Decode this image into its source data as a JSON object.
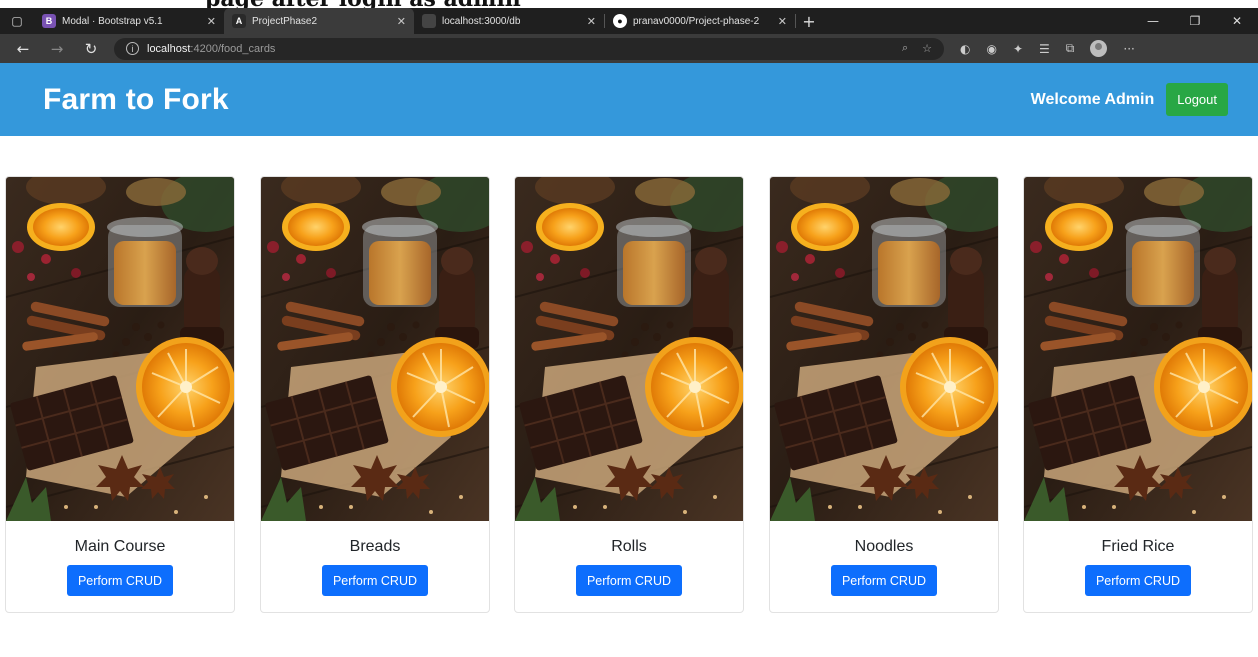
{
  "caption": "page after login as admin",
  "browser": {
    "tabs": [
      {
        "title": "Modal · Bootstrap v5.1",
        "favicon": "B",
        "favicon_color": "#7952b3",
        "active": false
      },
      {
        "title": "ProjectPhase2",
        "favicon": "A",
        "favicon_color": "#ffffff",
        "active": true
      },
      {
        "title": "localhost:3000/db",
        "favicon": "",
        "favicon_color": "#555555",
        "active": false
      },
      {
        "title": "pranav0000/Project-phase-2",
        "favicon": "github",
        "favicon_color": "#ffffff",
        "active": false
      }
    ],
    "url_host": "localhost",
    "url_path": ":4200/food_cards"
  },
  "navbar": {
    "brand": "Farm to Fork",
    "welcome": "Welcome Admin",
    "logout_label": "Logout",
    "bg_color": "#3498db",
    "logout_color": "#28a745"
  },
  "cards": [
    {
      "title": "Main Course",
      "button": "Perform CRUD"
    },
    {
      "title": "Breads",
      "button": "Perform CRUD"
    },
    {
      "title": "Rolls",
      "button": "Perform CRUD"
    },
    {
      "title": "Noodles",
      "button": "Perform CRUD"
    },
    {
      "title": "Fried Rice",
      "button": "Perform CRUD"
    }
  ],
  "colors": {
    "primary_button": "#0d6efd"
  }
}
